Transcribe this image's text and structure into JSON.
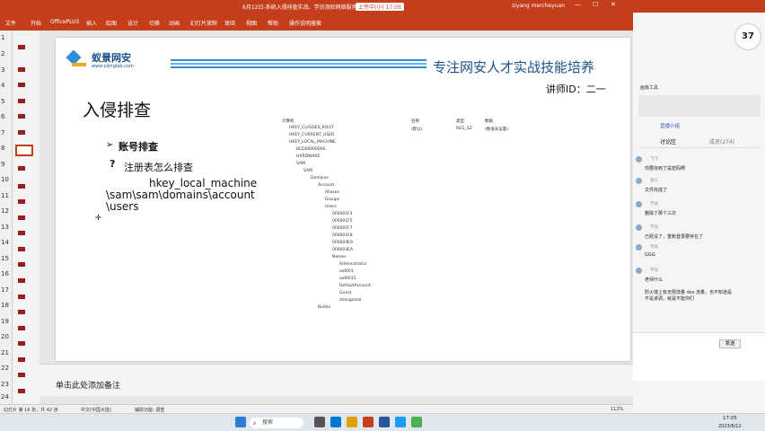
{
  "titlebar": {
    "title": "6月12日-系统入侵排查实战、学员测验网络服务实操...",
    "saving": "上传中(小) 17:05",
    "user": "ziyang mercheyuan"
  },
  "menu": [
    "文件",
    "开始",
    "OfficePLUS",
    "插入",
    "绘图",
    "设计",
    "切换",
    "动画",
    "幻灯片放映",
    "审阅",
    "视图",
    "帮助",
    "操作说明搜索"
  ],
  "slide": {
    "logo_cn": "蚁景网安",
    "logo_url": "www.yijinglab.com",
    "slogan": "专注网安人才实战技能培养",
    "lecturer": "讲师ID：二一",
    "title": "入侵排查",
    "bullet1": "账号排查",
    "bullet2": "注册表怎么排查",
    "path_line1": "hkey_local_machine",
    "path_line2": "\\sam\\sam\\domains\\account",
    "path_line3": "\\users",
    "regedit": {
      "tree": [
        "计算机",
        "HKEY_CLASSES_ROOT",
        "HKEY_CURRENT_USER",
        "HKEY_LOCAL_MACHINE",
        "BCD00000000",
        "HARDWARE",
        "SAM",
        "SAM",
        "Domains",
        "Account",
        "Aliases",
        "Groups",
        "Users",
        "000001F4",
        "000001F5",
        "000001F7",
        "000001F8",
        "000003E9",
        "000003EA",
        "Names",
        "Administrator",
        "aaf001",
        "aaf0015",
        "DefaultAccount",
        "Guest",
        "zhangsan$",
        "Builtin"
      ],
      "col_name": "名称",
      "col_type": "类型",
      "col_data": "数据",
      "row_name": "(默认)",
      "row_type": "REG_SZ",
      "row_data": "(数值未设置)"
    }
  },
  "notes": {
    "placeholder": "单击此处添加备注"
  },
  "status": {
    "slide": "幻灯片 第 16 张，共 42 张",
    "lang": "中文(中国大陆)",
    "accessibility": "辅助功能: 调查",
    "zoom": "112%"
  },
  "ruler": [
    "1",
    "2",
    "3",
    "4",
    "5",
    "6",
    "7",
    "8",
    "9",
    "10",
    "11",
    "12",
    "13",
    "14",
    "15",
    "16",
    "17",
    "18",
    "19",
    "20",
    "21",
    "22",
    "23",
    "24"
  ],
  "rightpane": {
    "badge": "37",
    "toolbar_title": "画板工具",
    "tab_live": "直播小组",
    "tab_discuss": "讨论区",
    "tab_members": "成员(274)",
    "messages": [
      {
        "name": "飞飞",
        "text": "你要找到了是密码啊"
      },
      {
        "name": "张三",
        "text": "文件完成了"
      },
      {
        "name": "学员",
        "text": "删除了那个三次"
      },
      {
        "name": "学员",
        "text": "已经没了，重新登录要存在了"
      },
      {
        "name": "学员",
        "text": "GGG"
      },
      {
        "name": "学员",
        "text": "老师什么"
      },
      {
        "name": "张伟",
        "text": "防火墙上有无限流量 dos 流量，也不知道是不是该调，就是不能你们"
      }
    ],
    "send": "发送"
  },
  "taskbar": {
    "search": "搜索",
    "time": "17:05",
    "date": "2023/6/12"
  }
}
